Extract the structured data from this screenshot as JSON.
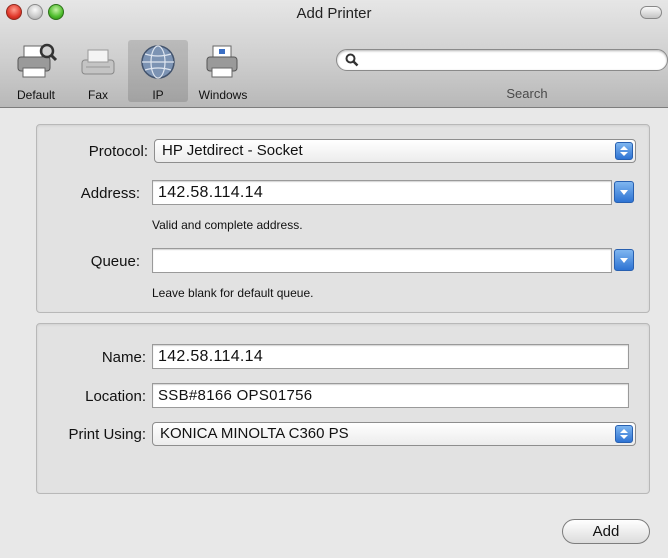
{
  "window": {
    "title": "Add Printer"
  },
  "toolbar": {
    "items": [
      {
        "label": "Default",
        "icon": "default-printer-icon"
      },
      {
        "label": "Fax",
        "icon": "fax-icon"
      },
      {
        "label": "IP",
        "icon": "ip-globe-icon",
        "selected": true
      },
      {
        "label": "Windows",
        "icon": "windows-printer-icon"
      }
    ],
    "search": {
      "placeholder": "",
      "value": "",
      "label": "Search"
    }
  },
  "connection": {
    "protocol_label": "Protocol:",
    "protocol_value": "HP Jetdirect - Socket",
    "address_label": "Address:",
    "address_value": "142.58.114.14",
    "address_hint": "Valid and complete address.",
    "queue_label": "Queue:",
    "queue_value": "",
    "queue_hint": "Leave blank for default queue."
  },
  "details": {
    "name_label": "Name:",
    "name_value": "142.58.114.14",
    "location_label": "Location:",
    "location_value": "SSB#8166 OPS01756",
    "print_using_label": "Print Using:",
    "print_using_value": "KONICA MINOLTA C360 PS"
  },
  "actions": {
    "add_label": "Add"
  },
  "colors": {
    "accent": "#2e73d3",
    "close": "#e0372a",
    "zoom": "#4cbc2a"
  }
}
